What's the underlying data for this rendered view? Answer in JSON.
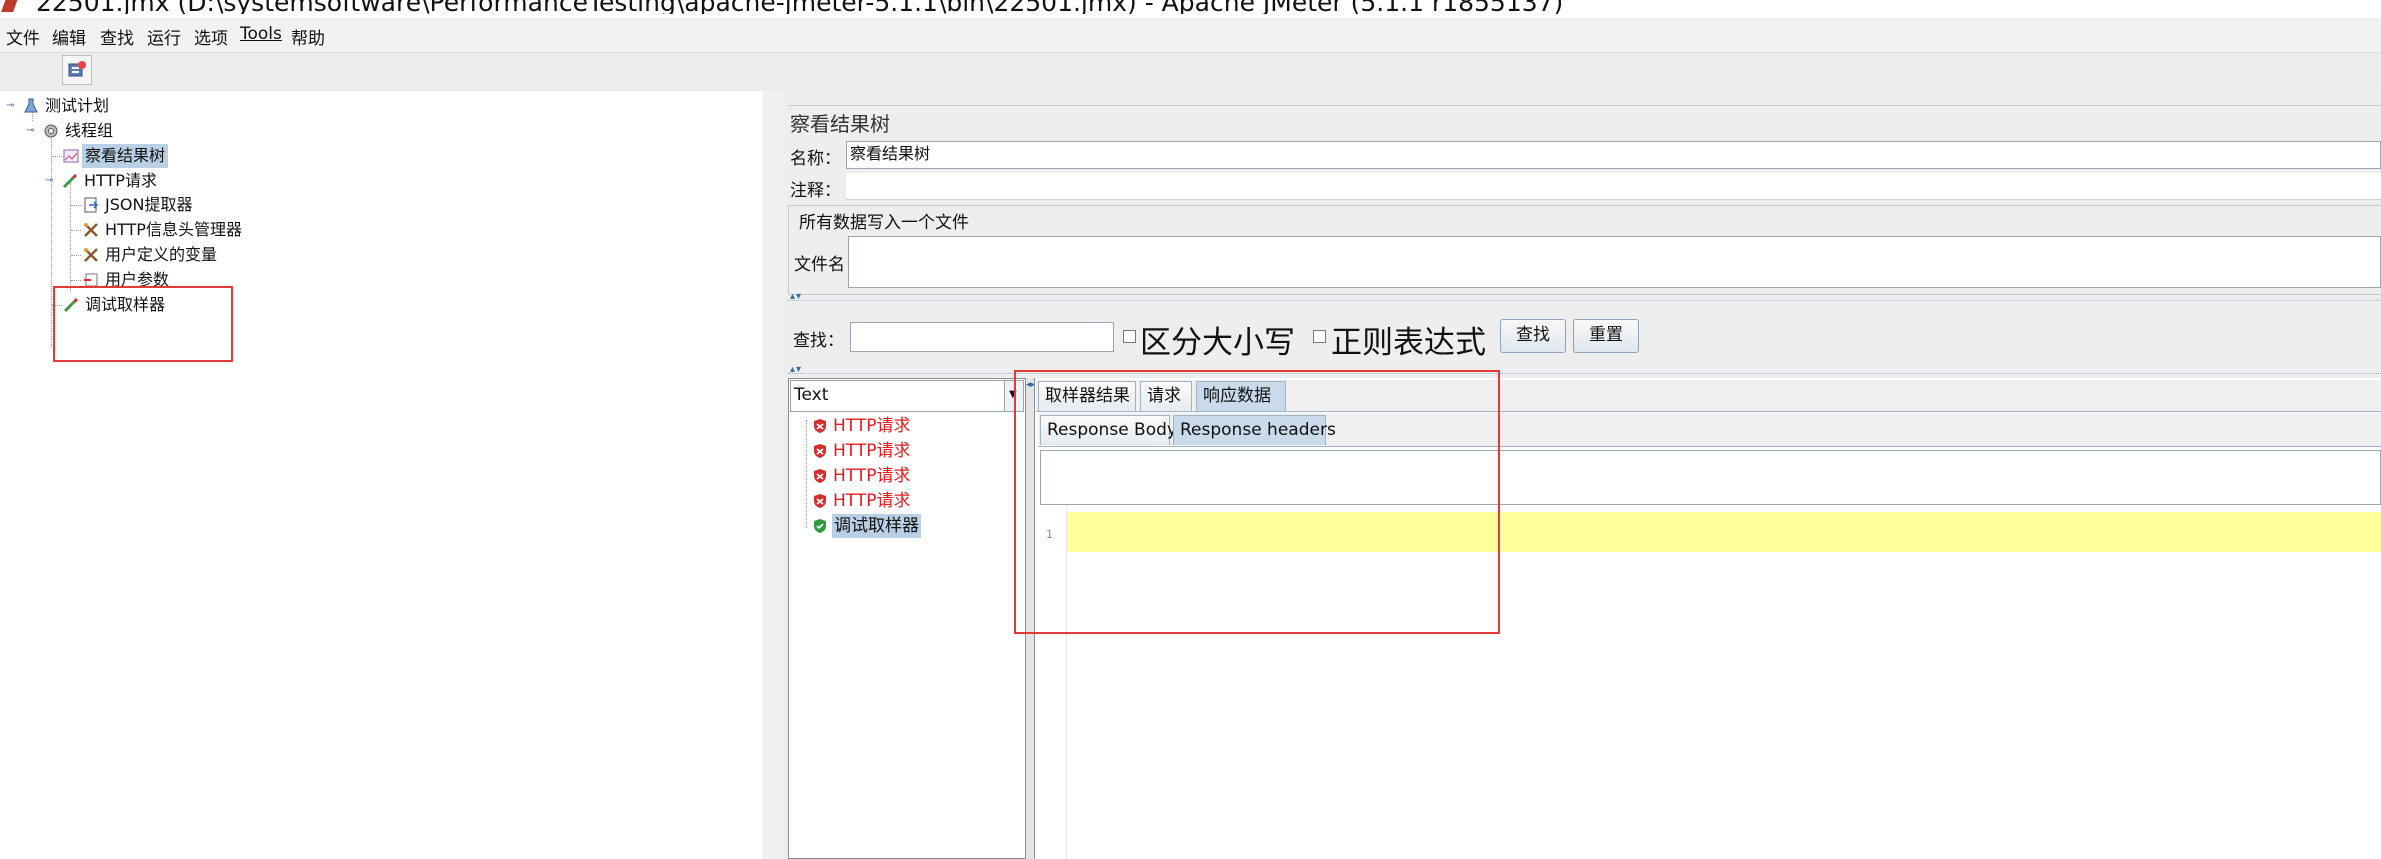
{
  "window": {
    "title": "22501.jmx (D:\\systemsoftware\\PerformanceTesting\\apache-jmeter-5.1.1\\bin\\22501.jmx) - Apache JMeter (5.1.1 r1855137)"
  },
  "menu": [
    "文件",
    "编辑",
    "查找",
    "运行",
    "选项",
    "Tools",
    "帮助"
  ],
  "toolbar": {
    "icon": "template-icon"
  },
  "tree": {
    "items": [
      {
        "label": "测试计划",
        "icon": "flask-icon"
      },
      {
        "label": "线程组",
        "icon": "gear-icon"
      },
      {
        "label": "察看结果树",
        "icon": "chart-icon"
      },
      {
        "label": "HTTP请求",
        "icon": "pipette-icon"
      },
      {
        "label": "JSON提取器",
        "icon": "extractor-icon"
      },
      {
        "label": "HTTP信息头管理器",
        "icon": "tools-icon"
      },
      {
        "label": "用户定义的变量",
        "icon": "tools-icon"
      },
      {
        "label": "用户参数",
        "icon": "params-icon"
      },
      {
        "label": "调试取样器",
        "icon": "pipette-icon"
      }
    ]
  },
  "panel": {
    "title": "察看结果树",
    "name_label": "名称：",
    "name_value": "察看结果树",
    "comment_label": "注释：",
    "comment_value": "",
    "file_group_label": "所有数据写入一个文件",
    "file_label": "文件名",
    "file_value": ""
  },
  "search": {
    "label": "查找：",
    "value": "",
    "case_label": "区分大小写",
    "regex_label": "正则表达式",
    "find_button": "查找",
    "reset_button": "重置"
  },
  "results": {
    "renderer": "Text",
    "items": [
      {
        "label": "HTTP请求",
        "status": "error"
      },
      {
        "label": "HTTP请求",
        "status": "error"
      },
      {
        "label": "HTTP请求",
        "status": "error"
      },
      {
        "label": "HTTP请求",
        "status": "error"
      },
      {
        "label": "调试取样器",
        "status": "ok"
      }
    ]
  },
  "detail": {
    "tabs": [
      "取样器结果",
      "请求",
      "响应数据"
    ],
    "active_tab": "响应数据",
    "subtabs": [
      "Response Body",
      "Response headers"
    ],
    "active_subtab": "Response headers",
    "line_number": "1"
  },
  "colors": {
    "error": "#e8191e",
    "selection": "#b8cfe5",
    "highlight_box": "#e53935",
    "current_line": "#ffff9e"
  }
}
